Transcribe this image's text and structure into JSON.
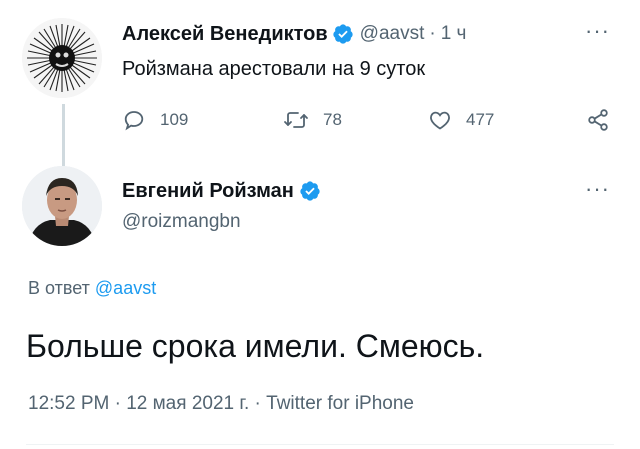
{
  "quoted_tweet": {
    "author_name": "Алексей Венедиктов",
    "handle": "@aavst",
    "separator": "·",
    "time_ago": "1 ч",
    "text": "Ройзмана арестовали на 9 суток",
    "actions": {
      "reply_count": "109",
      "retweet_count": "78",
      "like_count": "477"
    },
    "more_label": "···"
  },
  "main_tweet": {
    "author_name": "Евгений Ройзман",
    "handle": "@roizmangbn",
    "more_label": "···",
    "reply_prefix": "В ответ",
    "reply_to": "@aavst",
    "text": "Больше срока имели. Смеюсь.",
    "timestamp": "12:52 PM · 12 мая 2021 г. · Twitter for iPhone"
  },
  "colors": {
    "verified": "#1d9bf0",
    "link": "#1d9bf0",
    "secondary_text": "#536471",
    "divider": "#eff3f4"
  },
  "icons": [
    "verified-badge-icon",
    "reply-icon",
    "retweet-icon",
    "like-icon",
    "share-icon",
    "more-icon"
  ]
}
